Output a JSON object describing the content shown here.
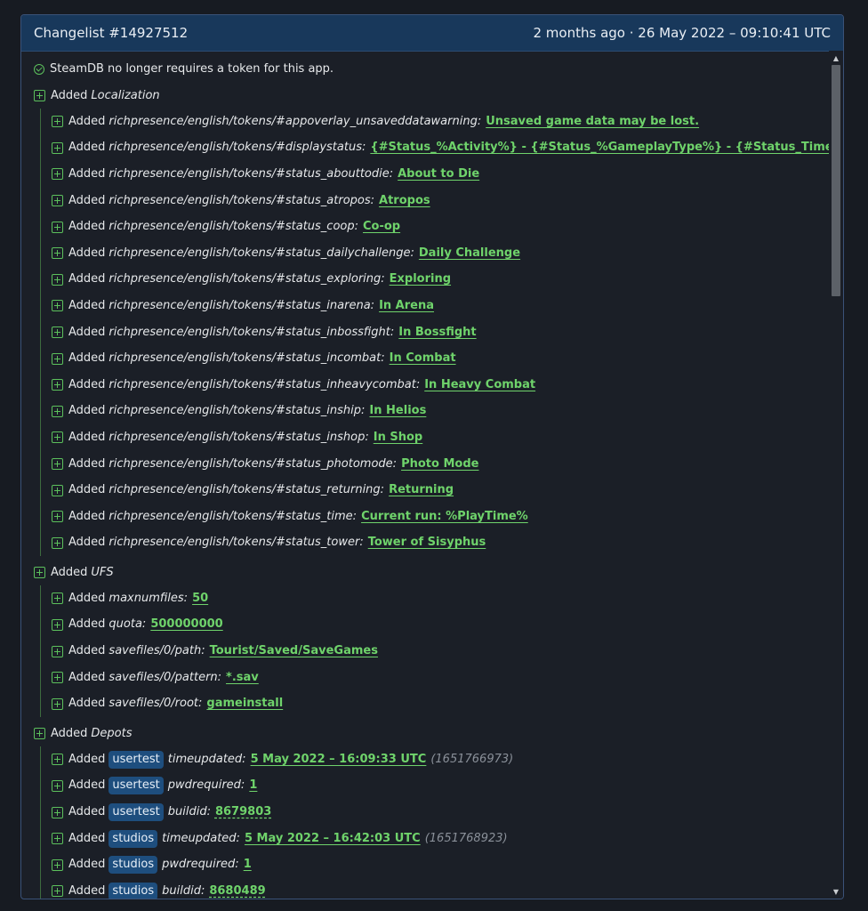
{
  "header": {
    "title": "Changelist #14927512",
    "time": "2 months ago · 26 May 2022 – 09:10:41 UTC"
  },
  "note": "SteamDB no longer requires a token for this app.",
  "added_word": "Added",
  "groups": [
    {
      "name": "Localization",
      "items": [
        {
          "key": "richpresence/english/tokens/#appoverlay_unsaveddatawarning:",
          "value": "Unsaved game data may be lost."
        },
        {
          "key": "richpresence/english/tokens/#displaystatus:",
          "value": "{#Status_%Activity%} - {#Status_%GameplayType%} - {#Status_Time}"
        },
        {
          "key": "richpresence/english/tokens/#status_abouttodie:",
          "value": "About to Die"
        },
        {
          "key": "richpresence/english/tokens/#status_atropos:",
          "value": "Atropos"
        },
        {
          "key": "richpresence/english/tokens/#status_coop:",
          "value": "Co-op"
        },
        {
          "key": "richpresence/english/tokens/#status_dailychallenge:",
          "value": "Daily Challenge"
        },
        {
          "key": "richpresence/english/tokens/#status_exploring:",
          "value": "Exploring"
        },
        {
          "key": "richpresence/english/tokens/#status_inarena:",
          "value": "In Arena"
        },
        {
          "key": "richpresence/english/tokens/#status_inbossfight:",
          "value": "In Bossfight"
        },
        {
          "key": "richpresence/english/tokens/#status_incombat:",
          "value": "In Combat"
        },
        {
          "key": "richpresence/english/tokens/#status_inheavycombat:",
          "value": "In Heavy Combat"
        },
        {
          "key": "richpresence/english/tokens/#status_inship:",
          "value": "In Helios"
        },
        {
          "key": "richpresence/english/tokens/#status_inshop:",
          "value": "In Shop"
        },
        {
          "key": "richpresence/english/tokens/#status_photomode:",
          "value": "Photo Mode"
        },
        {
          "key": "richpresence/english/tokens/#status_returning:",
          "value": "Returning"
        },
        {
          "key": "richpresence/english/tokens/#status_time:",
          "value": "Current run: %PlayTime%"
        },
        {
          "key": "richpresence/english/tokens/#status_tower:",
          "value": "Tower of Sisyphus"
        }
      ]
    },
    {
      "name": "UFS",
      "items": [
        {
          "key": "maxnumfiles:",
          "value": "50"
        },
        {
          "key": "quota:",
          "value": "500000000"
        },
        {
          "key": "savefiles/0/path:",
          "value": "Tourist/Saved/SaveGames"
        },
        {
          "key": "savefiles/0/pattern:",
          "value": "*.sav"
        },
        {
          "key": "savefiles/0/root:",
          "value": "gameinstall"
        }
      ]
    },
    {
      "name": "Depots",
      "items": [
        {
          "badge": "usertest",
          "key": "timeupdated:",
          "value": "5 May 2022 – 16:09:33 UTC",
          "extra": "(1651766973)"
        },
        {
          "badge": "usertest",
          "key": "pwdrequired:",
          "value": "1"
        },
        {
          "badge": "usertest",
          "key": "buildid:",
          "value": "8679803",
          "dashed": true
        },
        {
          "badge": "studios",
          "key": "timeupdated:",
          "value": "5 May 2022 – 16:42:03 UTC",
          "extra": "(1651768923)"
        },
        {
          "badge": "studios",
          "key": "pwdrequired:",
          "value": "1"
        },
        {
          "badge": "studios",
          "key": "buildid:",
          "value": "8680489",
          "dashed": true
        }
      ]
    }
  ],
  "icons": {
    "added": "plus-square-icon",
    "note": "check-circle-icon",
    "scroll_up": "triangle-up-icon",
    "scroll_down": "triangle-down-icon"
  },
  "colors": {
    "accent_green": "#6fd36b",
    "header_bg": "#18385b",
    "badge_bg": "#1e4e7e",
    "page_bg": "#171b22"
  }
}
